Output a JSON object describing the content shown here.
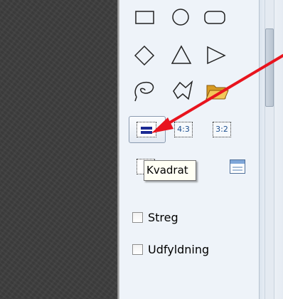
{
  "tooltip": {
    "text": "Kvadrat"
  },
  "ratio_buttons": [
    {
      "label": "4:3"
    },
    {
      "label": "3:2"
    }
  ],
  "text_tool": {
    "glyph": "I"
  },
  "options": [
    {
      "label": "Streg",
      "checked": false
    },
    {
      "label": "Udfyldning",
      "checked": false
    }
  ],
  "colors": {
    "panel_bg": "#eef3f9",
    "icon_accent": "#1c2a93",
    "arrow": "#e8141e",
    "tooltip_bg": "#fffff4",
    "folder": "#e9b43c"
  }
}
